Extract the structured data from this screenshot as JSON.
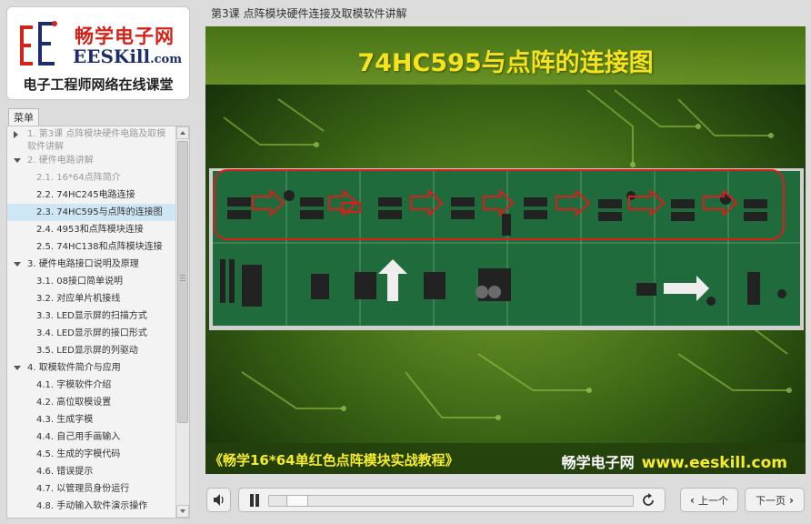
{
  "logo": {
    "mark": "E",
    "name_cn": "畅学电子网",
    "name_en": "EESKill",
    "name_en_suffix": ".com",
    "slogan": "电子工程师网络在线课堂"
  },
  "menu": {
    "tab_label": "菜单",
    "items": [
      {
        "label": "1. 第3课 点阵模块硬件电路及取模软件讲解",
        "level": 1,
        "expander": "right",
        "dim": true,
        "multi": true
      },
      {
        "label": "2. 硬件电路讲解",
        "level": 1,
        "expander": "down",
        "dim": true
      },
      {
        "label": "2.1. 16*64点阵简介",
        "level": 2,
        "dim": true
      },
      {
        "label": "2.2. 74HC245电路连接",
        "level": 2
      },
      {
        "label": "2.3. 74HC595与点阵的连接图",
        "level": 2,
        "active": true
      },
      {
        "label": "2.4. 4953和点阵模块连接",
        "level": 2
      },
      {
        "label": "2.5. 74HC138和点阵模块连接",
        "level": 2
      },
      {
        "label": "3. 硬件电路接口说明及原理",
        "level": 1,
        "expander": "down"
      },
      {
        "label": "3.1. 08接口简单说明",
        "level": 2
      },
      {
        "label": "3.2. 对应单片机接线",
        "level": 2
      },
      {
        "label": "3.3. LED显示屏的扫描方式",
        "level": 2
      },
      {
        "label": "3.4. LED显示屏的接口形式",
        "level": 2
      },
      {
        "label": "3.5. LED显示屏的列驱动",
        "level": 2
      },
      {
        "label": "4. 取模软件简介与应用",
        "level": 1,
        "expander": "down"
      },
      {
        "label": "4.1. 字模软件介绍",
        "level": 2
      },
      {
        "label": "4.2. 高位取模设置",
        "level": 2
      },
      {
        "label": "4.3. 生成字模",
        "level": 2
      },
      {
        "label": "4.4. 自己用手画输入",
        "level": 2
      },
      {
        "label": "4.5. 生成的字模代码",
        "level": 2
      },
      {
        "label": "4.6. 错误提示",
        "level": 2
      },
      {
        "label": "4.7. 以管理员身份运行",
        "level": 2
      },
      {
        "label": "4.8. 手动输入软件演示操作",
        "level": 2
      }
    ]
  },
  "lesson": {
    "title": "第3课 点阵模块硬件连接及取模软件讲解"
  },
  "video": {
    "slide_title": "74HC595与点阵的连接图",
    "caption_left": "《畅学16*64单红色点阵模块实战教程》",
    "caption_brand": "畅学电子网",
    "caption_url": "www.eeskill.com",
    "progress": 0.05
  },
  "controls": {
    "prev_label": "上一个",
    "next_label": "下一页"
  }
}
